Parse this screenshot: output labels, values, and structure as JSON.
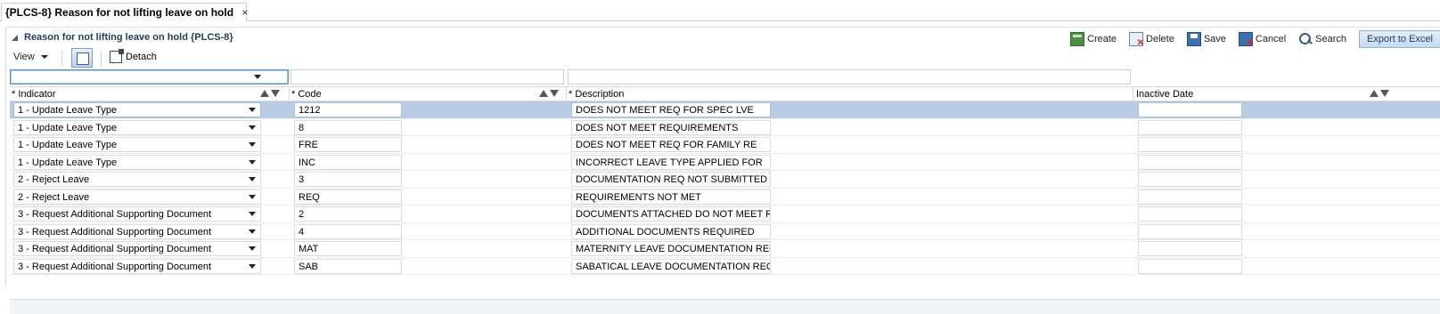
{
  "tab": {
    "title": "{PLCS-8} Reason for not lifting leave on hold",
    "close": "×"
  },
  "panel": {
    "title": "Reason for not lifting leave on hold {PLCS-8}"
  },
  "toolbar": {
    "create": "Create",
    "delete": "Delete",
    "save": "Save",
    "cancel": "Cancel",
    "search": "Search",
    "export": "Export to Excel"
  },
  "table_toolbar": {
    "view": "View",
    "detach": "Detach"
  },
  "columns": {
    "indicator": "* Indicator",
    "code": "* Code",
    "description": "* Description",
    "inactive_date": "Inactive Date"
  },
  "rows": [
    {
      "indicator": "1 - Update Leave Type",
      "code": "1212",
      "description": "DOES NOT MEET REQ FOR SPEC LVE",
      "inactive_date": ""
    },
    {
      "indicator": "1 - Update Leave Type",
      "code": "8",
      "description": "DOES NOT MEET REQUIREMENTS",
      "inactive_date": ""
    },
    {
      "indicator": "1 - Update Leave Type",
      "code": "FRE",
      "description": "DOES NOT MEET REQ FOR FAMILY RE",
      "inactive_date": ""
    },
    {
      "indicator": "1 - Update Leave Type",
      "code": "INC",
      "description": "INCORRECT LEAVE TYPE APPLIED FOR",
      "inactive_date": ""
    },
    {
      "indicator": "2 - Reject Leave",
      "code": "3",
      "description": "DOCUMENTATION REQ NOT SUBMITTED",
      "inactive_date": ""
    },
    {
      "indicator": "2 - Reject Leave",
      "code": "REQ",
      "description": "REQUIREMENTS NOT MET",
      "inactive_date": ""
    },
    {
      "indicator": "3 - Request Additional Supporting Document",
      "code": "2",
      "description": "DOCUMENTS ATTACHED DO NOT MEET REQ",
      "inactive_date": ""
    },
    {
      "indicator": "3 - Request Additional Supporting Document",
      "code": "4",
      "description": "ADDITIONAL DOCUMENTS REQUIRED",
      "inactive_date": ""
    },
    {
      "indicator": "3 - Request Additional Supporting Document",
      "code": "MAT",
      "description": "MATERNITY LEAVE DOCUMENTATION REQUI",
      "inactive_date": ""
    },
    {
      "indicator": "3 - Request Additional Supporting Document",
      "code": "SAB",
      "description": "SABATICAL LEAVE DOCUMENTATION REQUIR",
      "inactive_date": ""
    }
  ],
  "selected_row": 0,
  "colors": {
    "selected_row": "#b8cce4",
    "title": "#1f3b5c",
    "export_button": "#c5d9f0"
  }
}
